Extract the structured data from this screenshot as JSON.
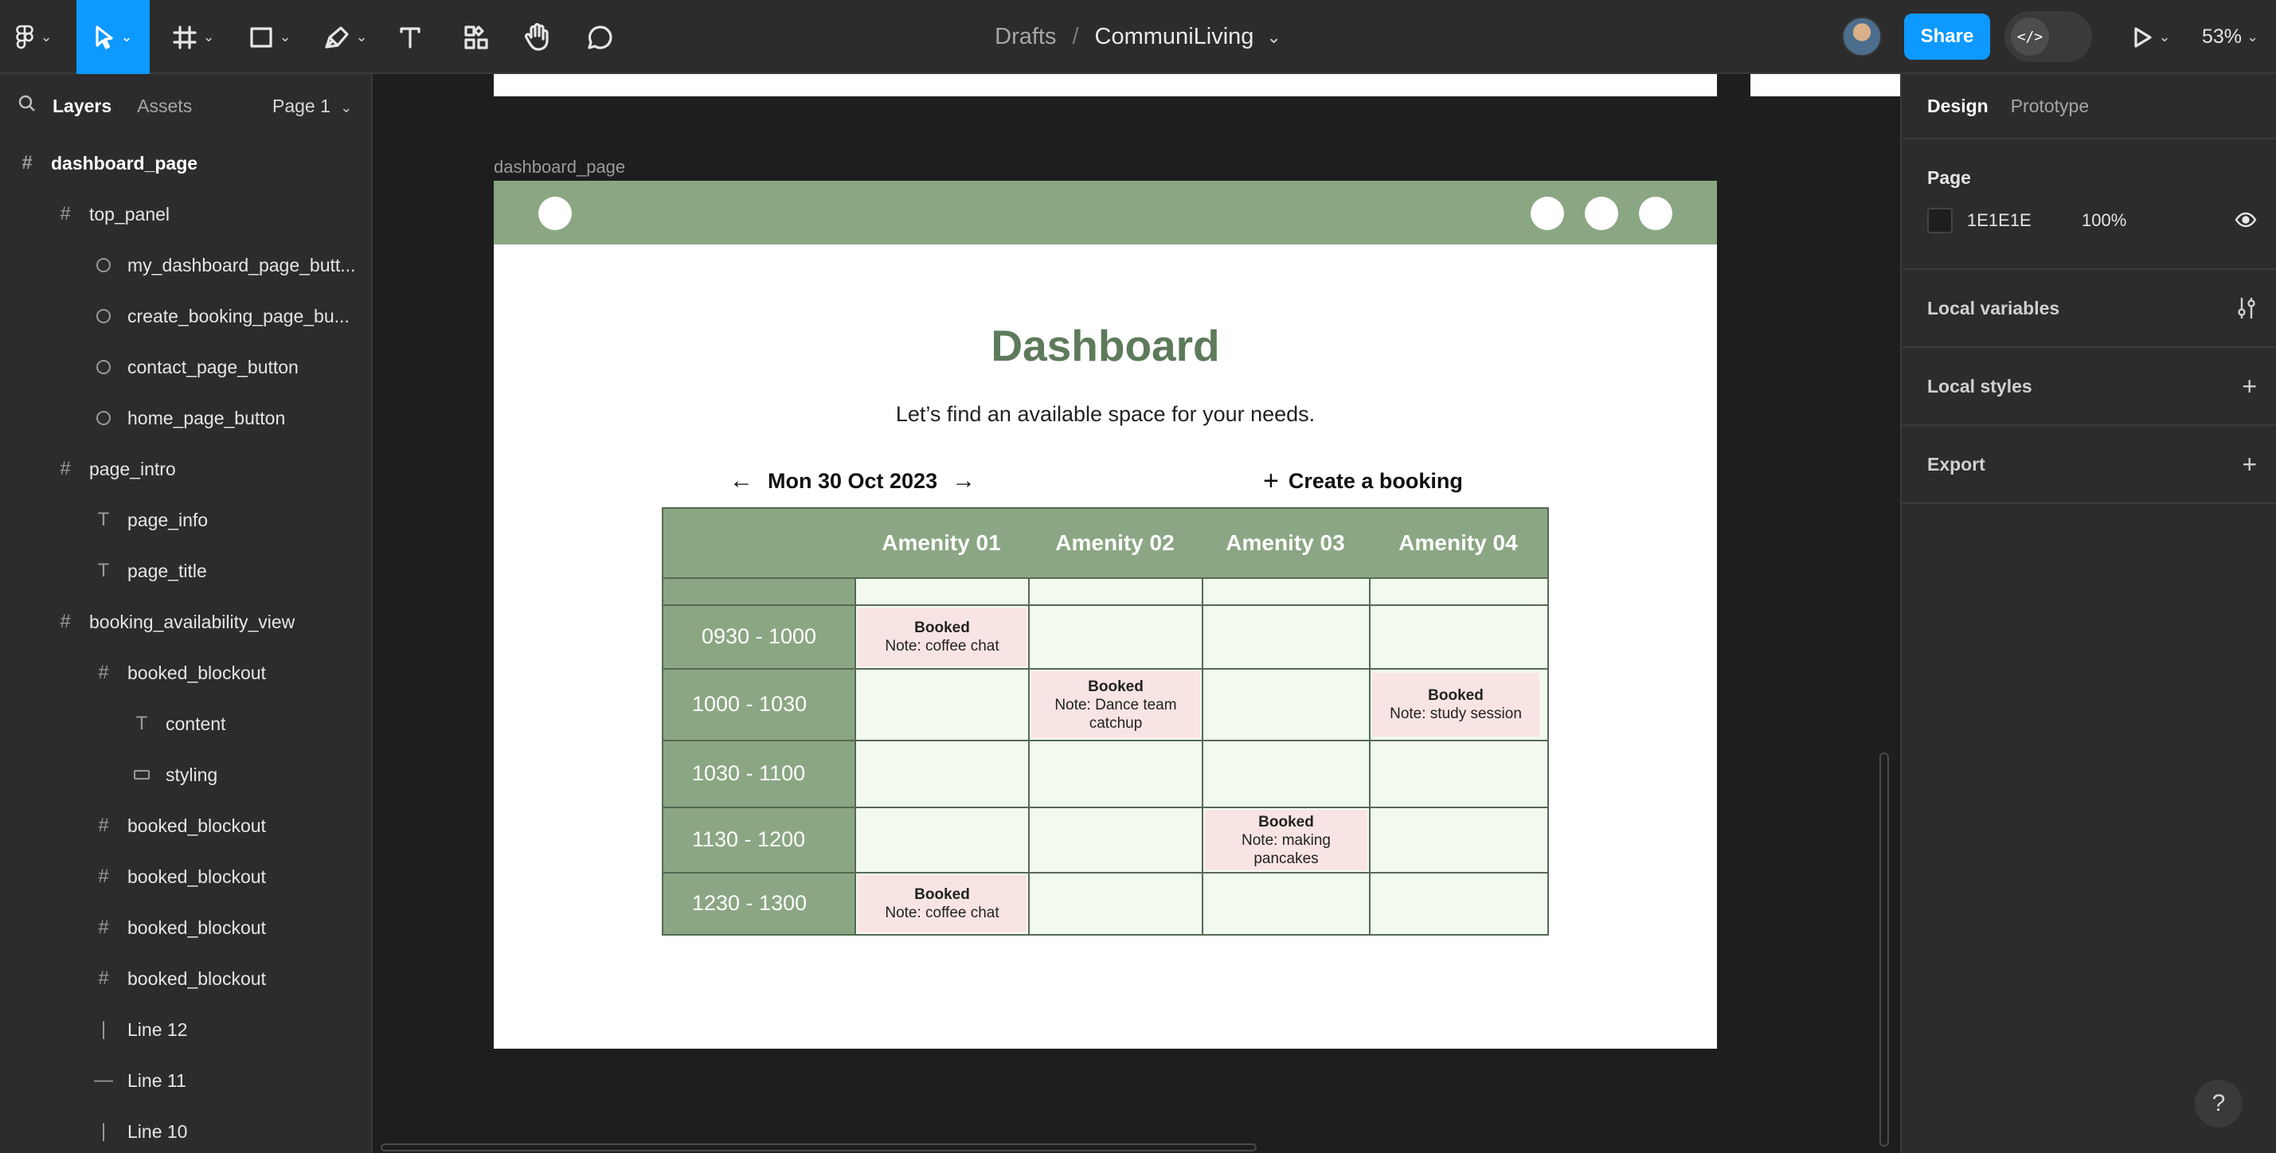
{
  "toolbar": {
    "breadcrumb_root": "Drafts",
    "breadcrumb_sep": "/",
    "file_name": "CommuniLiving",
    "share_label": "Share",
    "dev_mode_glyph": "</>",
    "zoom": "53%"
  },
  "left_panel": {
    "tab_layers": "Layers",
    "tab_assets": "Assets",
    "page_selector": "Page 1",
    "layers": [
      {
        "name": "dashboard_page",
        "icon": "frame-icon"
      },
      {
        "name": "top_panel",
        "icon": "frame-icon"
      },
      {
        "name": "my_dashboard_page_butt...",
        "icon": "ellipse-icon"
      },
      {
        "name": "create_booking_page_bu...",
        "icon": "ellipse-icon"
      },
      {
        "name": "contact_page_button",
        "icon": "ellipse-icon"
      },
      {
        "name": "home_page_button",
        "icon": "ellipse-icon"
      },
      {
        "name": "page_intro",
        "icon": "frame-icon"
      },
      {
        "name": "page_info",
        "icon": "text-icon"
      },
      {
        "name": "page_title",
        "icon": "text-icon"
      },
      {
        "name": "booking_availability_view",
        "icon": "frame-icon"
      },
      {
        "name": "booked_blockout",
        "icon": "frame-icon"
      },
      {
        "name": "content",
        "icon": "text-icon"
      },
      {
        "name": "styling",
        "icon": "rectangle-icon"
      },
      {
        "name": "booked_blockout",
        "icon": "frame-icon"
      },
      {
        "name": "booked_blockout",
        "icon": "frame-icon"
      },
      {
        "name": "booked_blockout",
        "icon": "frame-icon"
      },
      {
        "name": "booked_blockout",
        "icon": "frame-icon"
      },
      {
        "name": "Line 12",
        "icon": "line-vertical-icon"
      },
      {
        "name": "Line 11",
        "icon": "line-horizontal-icon"
      },
      {
        "name": "Line 10",
        "icon": "line-vertical-icon"
      }
    ]
  },
  "canvas": {
    "frame_label": "dashboard_page",
    "dashboard": {
      "title": "Dashboard",
      "subtitle": "Let’s find an available space for your needs.",
      "date": "Mon 30 Oct 2023",
      "create_label": "Create a booking",
      "amenities": [
        "Amenity 01",
        "Amenity 02",
        "Amenity 03",
        "Amenity 04"
      ],
      "times": [
        "0930 - 1000",
        "1000 - 1030",
        "1030 - 1100",
        "1130 - 1200",
        "1230 - 1300"
      ],
      "bookings": [
        {
          "status": "Booked",
          "note": "Note: coffee chat"
        },
        {
          "status": "Booked",
          "note": "Note: Dance team catchup"
        },
        {
          "status": "Booked",
          "note": "Note: study session"
        },
        {
          "status": "Booked",
          "note": "Note: making pancakes"
        },
        {
          "status": "Booked",
          "note": "Note: coffee chat"
        }
      ]
    }
  },
  "right_panel": {
    "tab_design": "Design",
    "tab_prototype": "Prototype",
    "page_heading": "Page",
    "page_color": "1E1E1E",
    "page_opacity": "100%",
    "local_variables": "Local variables",
    "local_styles": "Local styles",
    "export": "Export"
  },
  "colors": {
    "accent": "#0d99ff",
    "sage": "#8ba683",
    "title_green": "#5d7a5b",
    "booked_pink": "#f9e4e4"
  }
}
